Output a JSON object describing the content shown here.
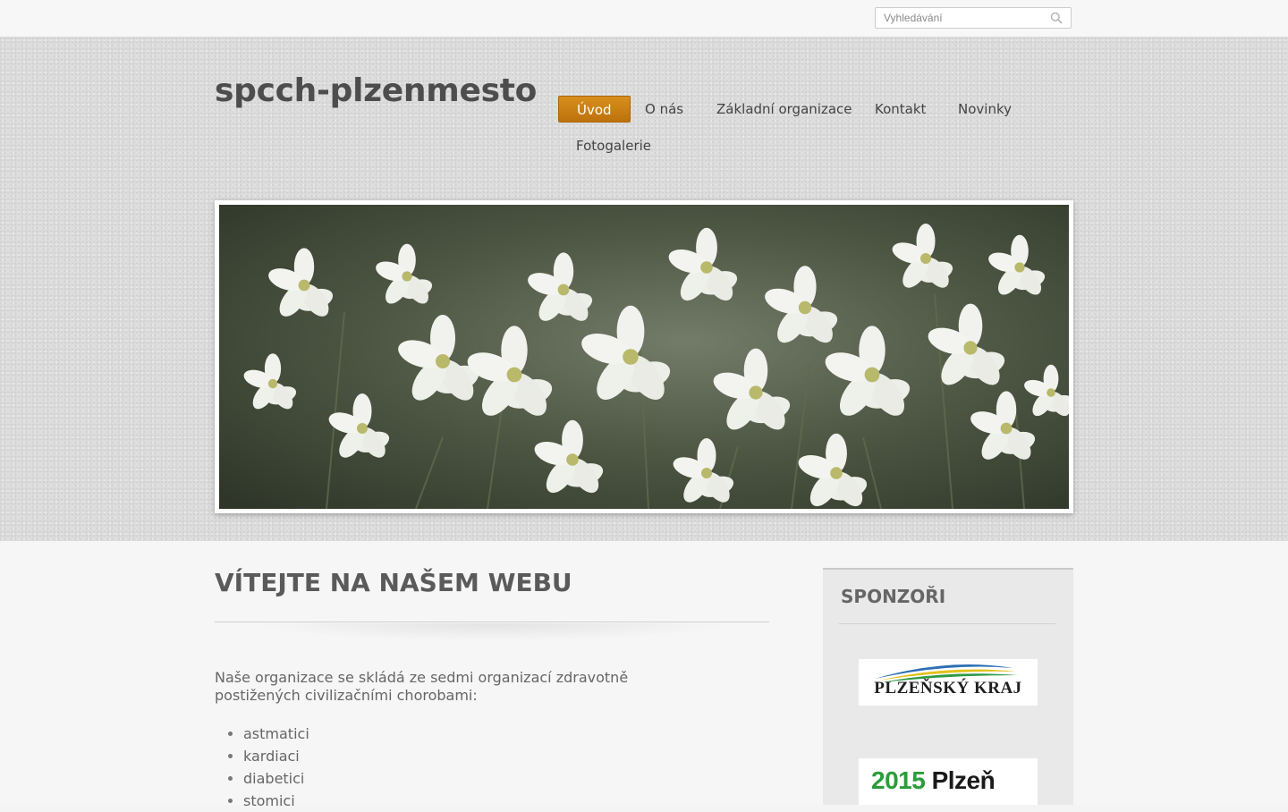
{
  "search": {
    "placeholder": "Vyhledávání"
  },
  "site": {
    "title": "spcch-plzenmesto"
  },
  "nav": {
    "items": [
      {
        "label": "Úvod",
        "active": true
      },
      {
        "label": "O nás"
      },
      {
        "label": "Základní organizace"
      },
      {
        "label": "Kontakt"
      },
      {
        "label": "Novinky"
      },
      {
        "label": "Fotogalerie"
      }
    ]
  },
  "main": {
    "heading": "VÍTEJTE NA NAŠEM WEBU",
    "intro": "Naše organizace se skládá ze sedmi organizací zdravotně postižených civilizačními chorobami:",
    "list": [
      "astmatici",
      "kardiaci",
      "diabetici",
      "stomici"
    ]
  },
  "sidebar": {
    "heading": "SPONZOŘI",
    "sponsors": [
      {
        "text": "PLZEŇSKÝ KRAJ"
      },
      {
        "text_num": "2015",
        "text_city": "Plzeň"
      }
    ]
  },
  "colors": {
    "accent": "#c77b12",
    "text": "#555555"
  }
}
